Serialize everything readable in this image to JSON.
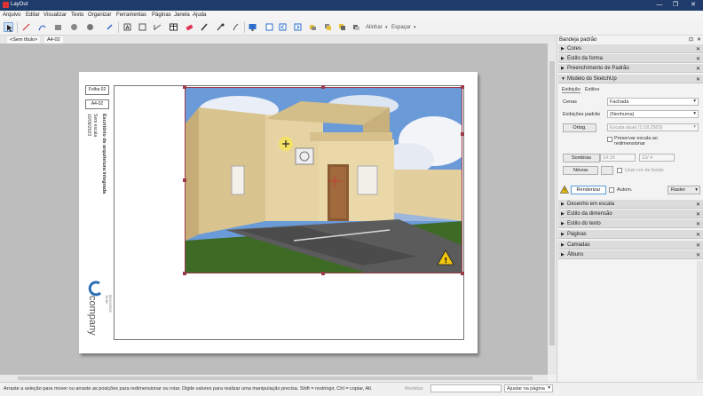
{
  "window": {
    "title": "LayOut",
    "minimize": "—",
    "maximize": "❐",
    "close": "✕"
  },
  "menu": [
    "Arquivo",
    "Editar",
    "Visualizar",
    "Texto",
    "Organizar",
    "Ferramentas",
    "Páginas",
    "Janela",
    "Ajuda"
  ],
  "toolbar": {
    "alinhar_label": "Alinhar",
    "espacar_label": "Espaçar"
  },
  "tabs": {
    "document": "<Sem título>",
    "paper_size": "A4-02"
  },
  "sheet": {
    "page_box": "Folha 02",
    "size_box": "A4-02",
    "project_title": "Escritório de arquitetura integrada",
    "info_lines": [
      "Sem escala",
      "10/06/2023"
    ],
    "company_top": "RESOURCE TEAM",
    "company_name": "company"
  },
  "status": {
    "hint": "Arraste a seleção para mover ou arraste as posições para redimensionar ou rotar. Digite valores para realizar uma manipulação precisa. Shift = restringir, Ctrl = copiar, Alt.",
    "measures_label": "Medidas",
    "measures_value": "",
    "zoom_value": "Ajustar na página"
  },
  "tray": {
    "title": "Bandeja padrão",
    "sections_top": [
      {
        "name": "Cores"
      },
      {
        "name": "Estilo da forma"
      },
      {
        "name": "Preenchimento de Padrão"
      }
    ],
    "sketchup_section": "Modelo do SketchUp",
    "subtabs": [
      "Exibição",
      "Estilos"
    ],
    "cenas_label": "Cenas",
    "cenas_value": "Fachada",
    "exibicoes_label": "Exibições padrão",
    "exibicoes_value": "(Nenhuma)",
    "ortog_button": "Ortog.",
    "escala_value": "Escala atual (1:18,2503)",
    "preservar_label": "Preservar escala ao redimensionar",
    "sombras_button": "Sombras",
    "time_value": "14:16",
    "date_value": "12/ 4",
    "nevoa_button": "Névoa",
    "usar_cor_label": "Usar cor de fundo",
    "renderizar_button": "Renderizar",
    "auto_label": "Autom.",
    "raster_value": "Raster",
    "sections_bottom": [
      {
        "name": "Desenho em escala"
      },
      {
        "name": "Estilo da dimensão"
      },
      {
        "name": "Estilo do texto"
      },
      {
        "name": "Páginas"
      },
      {
        "name": "Camadas"
      },
      {
        "name": "Álbuns"
      }
    ]
  },
  "colors": {
    "accent": "#9a3b4a",
    "titlebar": "#1f3b6b",
    "sky": "#5b8fd6",
    "wall": "#e3cf9e",
    "grass": "#3d6a25"
  }
}
